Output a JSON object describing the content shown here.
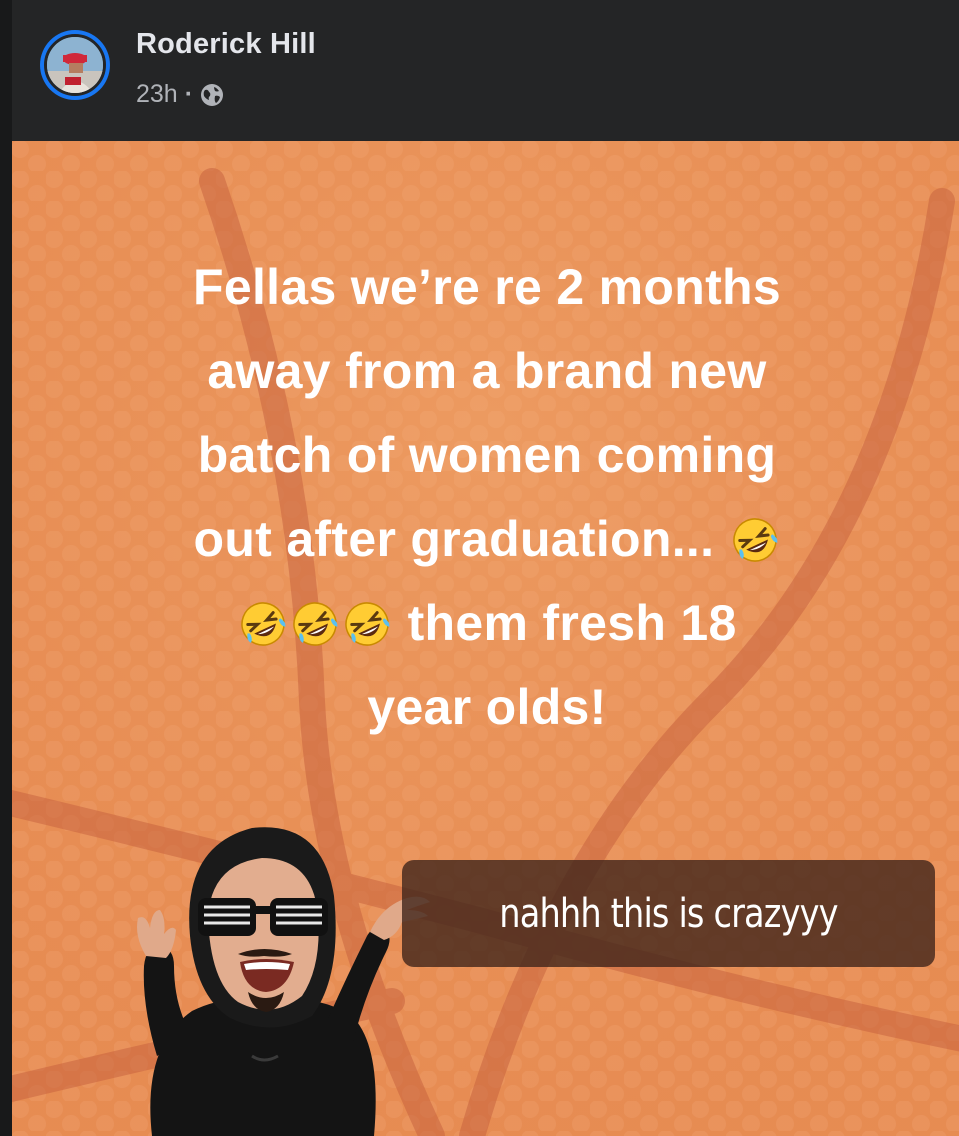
{
  "post": {
    "author": "Roderick Hill",
    "time": "23h",
    "separator": "·",
    "privacy_icon": "globe-icon"
  },
  "story": {
    "lines": [
      "Fellas we’re re 2 months",
      "away from a brand new",
      "batch of women coming",
      "out after graduation...",
      "them fresh 18",
      "year olds!"
    ],
    "emoji_icon": "rolling-on-floor-laughing-emoji",
    "caption": "nahhh this is crazyyy",
    "background_color": "#e99157",
    "pattern_color": "#f3b07e",
    "line_color": "#c9643f"
  }
}
